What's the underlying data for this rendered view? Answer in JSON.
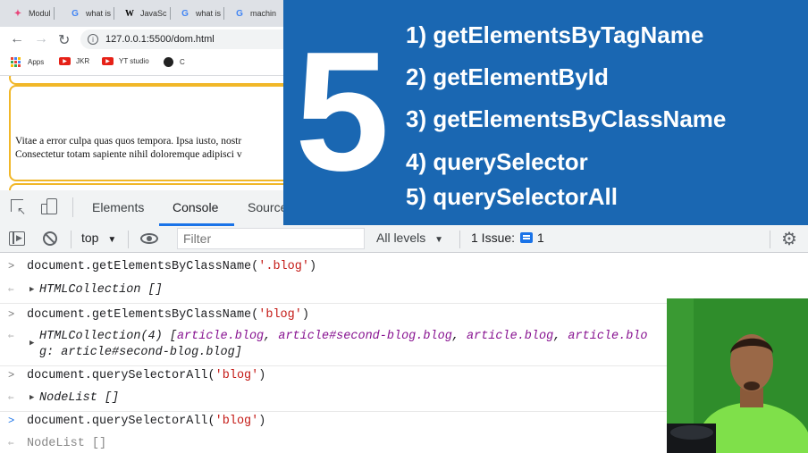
{
  "browser": {
    "tabs": [
      {
        "label": "Modul",
        "icon": "puzzle-icon"
      },
      {
        "label": "what is",
        "icon": "google-icon"
      },
      {
        "label": "JavaSc",
        "icon": "wikipedia-icon"
      },
      {
        "label": "what is",
        "icon": "google-icon"
      },
      {
        "label": "machin",
        "icon": "google-icon"
      }
    ],
    "url": "127.0.0.1:5500/dom.html",
    "bookmarks": [
      {
        "label": "Apps",
        "icon": "apps-grid-icon"
      },
      {
        "label": "JKR",
        "icon": "youtube-icon"
      },
      {
        "label": "YT studio",
        "icon": "youtube-icon"
      },
      {
        "label": "C",
        "icon": "github-icon"
      }
    ]
  },
  "page": {
    "lines": [
      "Vitae a error culpa quas quos tempora. Ipsa iusto, nostr",
      "Consectetur totam sapiente nihil doloremque adipisci v"
    ]
  },
  "devtools": {
    "tabs": [
      "Elements",
      "Console",
      "Sources"
    ],
    "active_tab": "Console",
    "context": "top",
    "filter_placeholder": "Filter",
    "levels": "All levels",
    "issues_label": "1 Issue:",
    "issues_count": "1"
  },
  "console": {
    "entries": [
      {
        "cmd": "document.getElementsByClassName(",
        "arg": "'.blog'",
        "close": ")",
        "result": "HTMLCollection []"
      },
      {
        "cmd": "document.getElementsByClassName(",
        "arg": "'blog'",
        "close": ")",
        "result_head": "HTMLCollection(4) [",
        "result_items": [
          "article.blog",
          "article#second-blog.blog",
          "article.blog",
          "article.blo"
        ],
        "result_tail": "g: article#second-blog.blog]"
      },
      {
        "cmd": "document.querySelectorAll(",
        "arg": "'blog'",
        "close": ")",
        "result": "NodeList []"
      },
      {
        "cmd": "document.querySelectorAll(",
        "arg": "'blog'",
        "close": ")",
        "result": "NodeList []"
      }
    ]
  },
  "banner": {
    "number": "5",
    "items": [
      "1) getElementsByTagName",
      "2) getElementById",
      "3) getElementsByClassName",
      "4) querySelector",
      "5) querySelectorAll"
    ]
  },
  "colors": {
    "banner_bg": "#1a67b2",
    "devtools_accent": "#1a73e8",
    "article_border": "#f1b728",
    "string": "#c41a16"
  }
}
